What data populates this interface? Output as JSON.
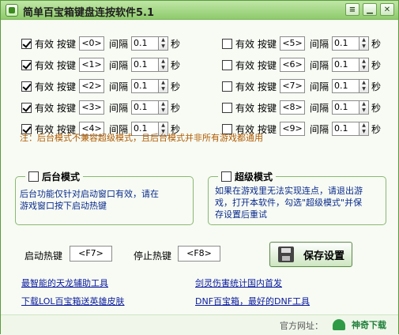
{
  "window": {
    "title": "简单百宝箱键盘连按软件5.1",
    "buttons": {
      "settings": "≡",
      "minimize": "▁",
      "close": "✕"
    }
  },
  "keys": {
    "valid_label": "有效",
    "key_label": "按键",
    "interval_label": "间隔",
    "seconds_label": "秒",
    "left": [
      {
        "checked": true,
        "key": "<0>",
        "interval": "0.1"
      },
      {
        "checked": true,
        "key": "<1>",
        "interval": "0.1"
      },
      {
        "checked": true,
        "key": "<2>",
        "interval": "0.1"
      },
      {
        "checked": true,
        "key": "<3>",
        "interval": "0.1"
      },
      {
        "checked": true,
        "key": "<4>",
        "interval": "0.1"
      }
    ],
    "right": [
      {
        "checked": false,
        "key": "<5>",
        "interval": "0.1"
      },
      {
        "checked": false,
        "key": "<6>",
        "interval": "0.1"
      },
      {
        "checked": false,
        "key": "<7>",
        "interval": "0.1"
      },
      {
        "checked": false,
        "key": "<8>",
        "interval": "0.1"
      },
      {
        "checked": false,
        "key": "<9>",
        "interval": "0.1"
      }
    ]
  },
  "note": "注：后台模式不兼容超级模式，且后台模式并非所有游戏都通用",
  "background_mode": {
    "title": "后台模式",
    "checked": false,
    "desc_line1": "后台功能仅针对启动窗口有效，请在",
    "desc_line2": "游戏窗口按下启动热键"
  },
  "super_mode": {
    "title": "超级模式",
    "checked": false,
    "desc_line1": "如果在游戏里无法实现连点，请退出游",
    "desc_line2": "戏，打开本软件，勾选\"超级模式\"并保",
    "desc_line3": "存设置后重试"
  },
  "hotkeys": {
    "start_label": "启动热键",
    "start_value": "<F7>",
    "stop_label": "停止热键",
    "stop_value": "<F8>"
  },
  "save_button": "保存设置",
  "links": {
    "l1": "最智能的天龙辅助工具",
    "l2": "下载LOL百宝箱送英雄皮肤",
    "r1": "剑灵伤害统计国内首发",
    "r2": "DNF百宝箱，最好的DNF工具"
  },
  "footer": {
    "text": "官方网址：",
    "watermark": "神奇下载"
  }
}
